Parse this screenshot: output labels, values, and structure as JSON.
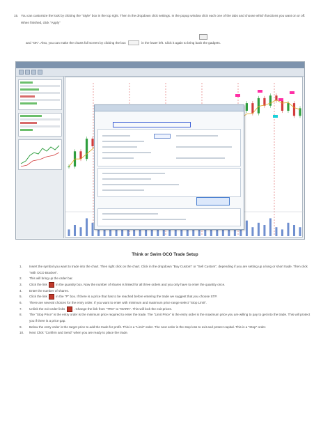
{
  "intro": {
    "step_number": "15.",
    "para1": "You can customize the look by clicking the \"Style\" box in the top right. Then in the dropdown click settings. In the popup window click each one of the tabs and choose which functions you want on or off. When finished, click \"Apply\"",
    "para2a": "and \"OK\". Also, you can make the charts full screen by clicking the box",
    "para2b": "in the lower left. Click it again to bring back the gadgets."
  },
  "section_title": "Think or Swim OCO Trade Setup",
  "steps": [
    {
      "n": "1.",
      "text": "Insert the symbol you want to trade into the chart. Then right click on the chart. Click in the dropdown \"Buy Custom\" or \"Sell Custom\", depending if you are setting up a long or short trade. Then click \"with OCO Bracket\"."
    },
    {
      "n": "2.",
      "text": "This will bring up the order bar."
    },
    {
      "n": "3.",
      "pre": "Click the link",
      "post": "in the quantity box. Now the number of shares is linked for all three orders and you only have to enter the quantity once.",
      "icon": true
    },
    {
      "n": "4.",
      "text": "Enter the number of shares."
    },
    {
      "n": "5.",
      "pre": "Click the link",
      "post": "in the \"P\" box. If there is a price that has to be reached before entering the trade we suggest that you choose STP.",
      "icon": true
    },
    {
      "n": "6.",
      "text": "There are several choices for the entry order. If you want to enter with minimum and maximum price range select \"Stop Limit\"."
    },
    {
      "n": "7.",
      "pre": "Unlink the exit order links",
      "post": ". Change the link from \"TRG\" to \"MARK\". This will lock the exit prices.",
      "icon": true
    },
    {
      "n": "8.",
      "text": "The \"Stop Price\" is the entry order is the minimum price required to enter the trade. The \"Limit Price\" is the entry order is the maximum price you are willing to pay to get into the trade. This will protect you if there is a price gap."
    },
    {
      "n": "9.",
      "text": "Below the entry order is the target price to add the trade for profit. This is a \"Limit\" order. The next order is the stop loss to exit and protect capital. This is a \"Stop\" order."
    },
    {
      "n": "10.",
      "text": "Next Click \"Confirm and Send\" when you are ready to place the trade."
    }
  ],
  "colors": {
    "accent_blue": "#3b5ed6",
    "chart_green": "#2e9e3e",
    "chart_red": "#d23c3c",
    "chart_pink": "#ff2fa6",
    "chart_cyan": "#1ad0d8",
    "icon_red": "#c0392b"
  },
  "chart_series": {
    "price": [
      52,
      58,
      55,
      63,
      60,
      66,
      64,
      70,
      62,
      57,
      60,
      54,
      50,
      47,
      44,
      46,
      42,
      45,
      48,
      44,
      41,
      46,
      52,
      58,
      62,
      66,
      70,
      72,
      68,
      74,
      77,
      73,
      79,
      76,
      80,
      78,
      74,
      77,
      72,
      75
    ],
    "volume": [
      0.3,
      0.5,
      0.4,
      0.8,
      0.6,
      0.3,
      0.9,
      0.5,
      0.4,
      0.7,
      0.3,
      0.6,
      0.5,
      0.4,
      1.0,
      0.5,
      0.3,
      0.6,
      0.4,
      0.7,
      0.5,
      0.4,
      0.8,
      0.3,
      0.5,
      0.6,
      0.4,
      0.9,
      0.5,
      0.3,
      0.7,
      0.4,
      0.6,
      0.5,
      0.8,
      0.4,
      0.3,
      0.6,
      0.5,
      0.4
    ]
  }
}
